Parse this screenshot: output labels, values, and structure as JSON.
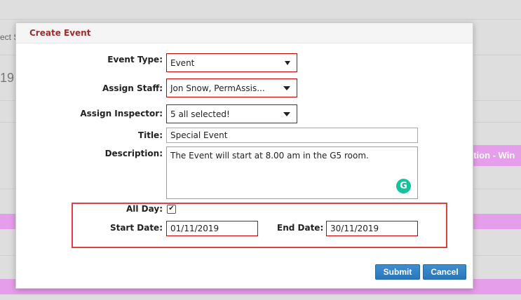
{
  "background": {
    "partial_text_1": "ect S",
    "partial_text_2": "19",
    "band_text": "ation - Win"
  },
  "modal": {
    "title": "Create Event",
    "event_type": {
      "label": "Event Type:",
      "value": "Event"
    },
    "assign_staff": {
      "label": "Assign Staff:",
      "value": "Jon Snow, PermAssis..."
    },
    "assign_inspector": {
      "label": "Assign Inspector:",
      "value": "5 all selected!"
    },
    "title_field": {
      "label": "Title:",
      "value": "Special Event"
    },
    "description": {
      "label": "Description:",
      "value": "The Event will start at 8.00 am in the G5 room."
    },
    "all_day": {
      "label": "All Day:",
      "checked": true,
      "mark": "✔"
    },
    "start_date": {
      "label": "Start Date:",
      "value": "01/11/2019"
    },
    "end_date": {
      "label": "End Date:",
      "value": "30/11/2019"
    },
    "submit_label": "Submit",
    "cancel_label": "Cancel"
  },
  "colors": {
    "title": "#a52a2a",
    "error_border": "#cc0000",
    "highlight": "#e04040",
    "button": "#2f80c4",
    "band": "#e59ee9",
    "grammarly": "#15c39a"
  }
}
